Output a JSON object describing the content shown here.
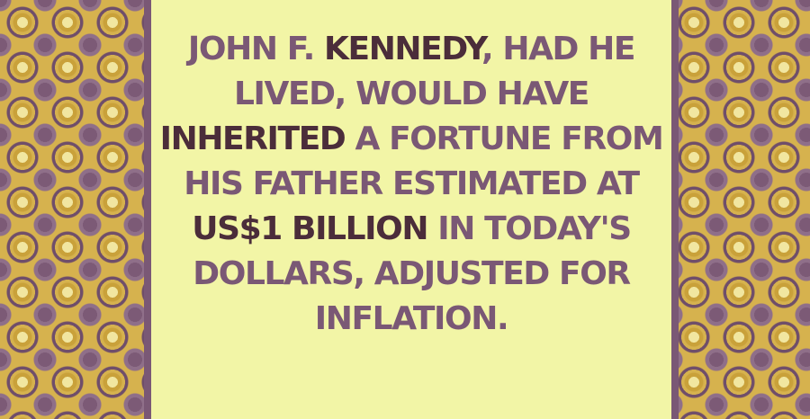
{
  "fact": {
    "segments": [
      {
        "text": "JOHN F. ",
        "highlight": false
      },
      {
        "text": "KENNEDY",
        "highlight": true
      },
      {
        "text": ", HAD HE LIVED, WOULD HAVE ",
        "highlight": false
      },
      {
        "text": "INHERITED",
        "highlight": true
      },
      {
        "text": " A FORTUNE FROM HIS FATHER ESTIMATED AT ",
        "highlight": false
      },
      {
        "text": "US$1 BILLION",
        "highlight": true
      },
      {
        "text": " IN TODAY'S DOLLARS, ADJUSTED FOR INFLATION.",
        "highlight": false
      }
    ]
  },
  "colors": {
    "background": "#f2f5a6",
    "text": "#7a5875",
    "highlight_text": "#4b2d3a",
    "border_gold": "#d6b24e",
    "border_purple": "#7a5875"
  },
  "decorations": {
    "left_border": "ornamental-floral-pattern",
    "right_border": "ornamental-floral-pattern"
  }
}
